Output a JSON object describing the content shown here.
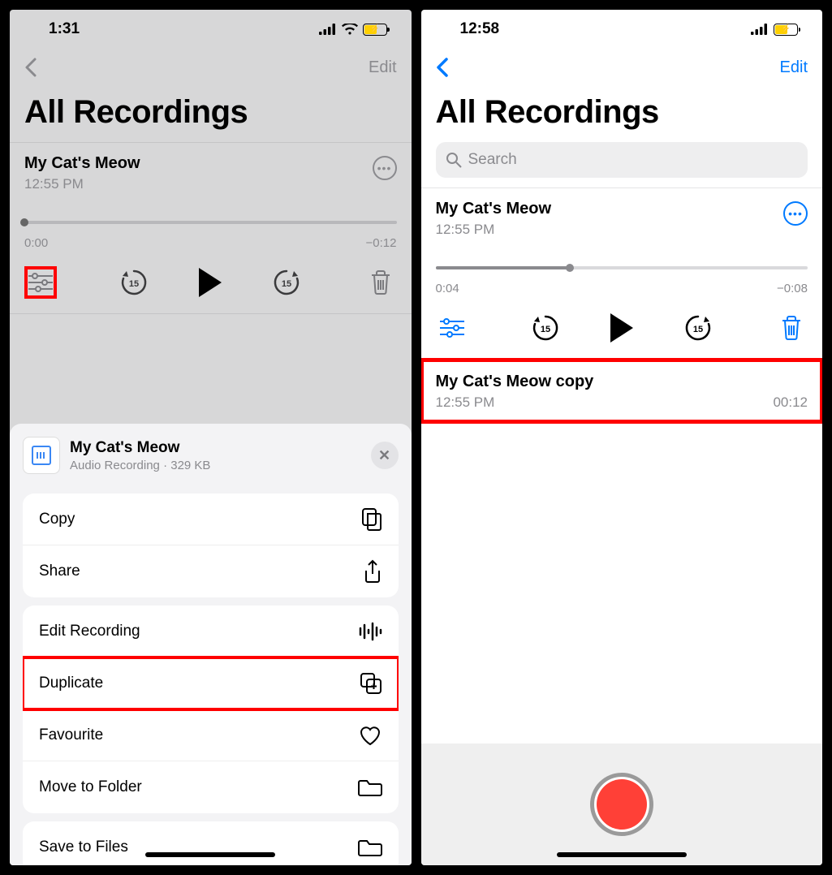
{
  "left": {
    "status": {
      "time": "1:31"
    },
    "nav": {
      "edit": "Edit"
    },
    "title": "All Recordings",
    "recording": {
      "title": "My Cat's Meow",
      "time": "12:55 PM",
      "scrub": {
        "start": "0:00",
        "end": "−0:12",
        "progress_pct": 0
      }
    },
    "sheet": {
      "title": "My Cat's Meow",
      "subtitle": "Audio Recording · 329 KB",
      "items": [
        {
          "label": "Copy",
          "icon": "copy"
        },
        {
          "label": "Share",
          "icon": "share"
        },
        {
          "label": "Edit Recording",
          "icon": "waveform"
        },
        {
          "label": "Duplicate",
          "icon": "duplicate",
          "highlight": true
        },
        {
          "label": "Favourite",
          "icon": "heart"
        },
        {
          "label": "Move to Folder",
          "icon": "folder"
        },
        {
          "label": "Save to Files",
          "icon": "folder"
        }
      ]
    }
  },
  "right": {
    "status": {
      "time": "12:58"
    },
    "nav": {
      "edit": "Edit"
    },
    "title": "All Recordings",
    "search_placeholder": "Search",
    "recording": {
      "title": "My Cat's Meow",
      "time": "12:55 PM",
      "scrub": {
        "start": "0:04",
        "end": "−0:08",
        "progress_pct": 36
      }
    },
    "copy": {
      "title": "My Cat's Meow copy",
      "time": "12:55 PM",
      "duration": "00:12"
    }
  }
}
